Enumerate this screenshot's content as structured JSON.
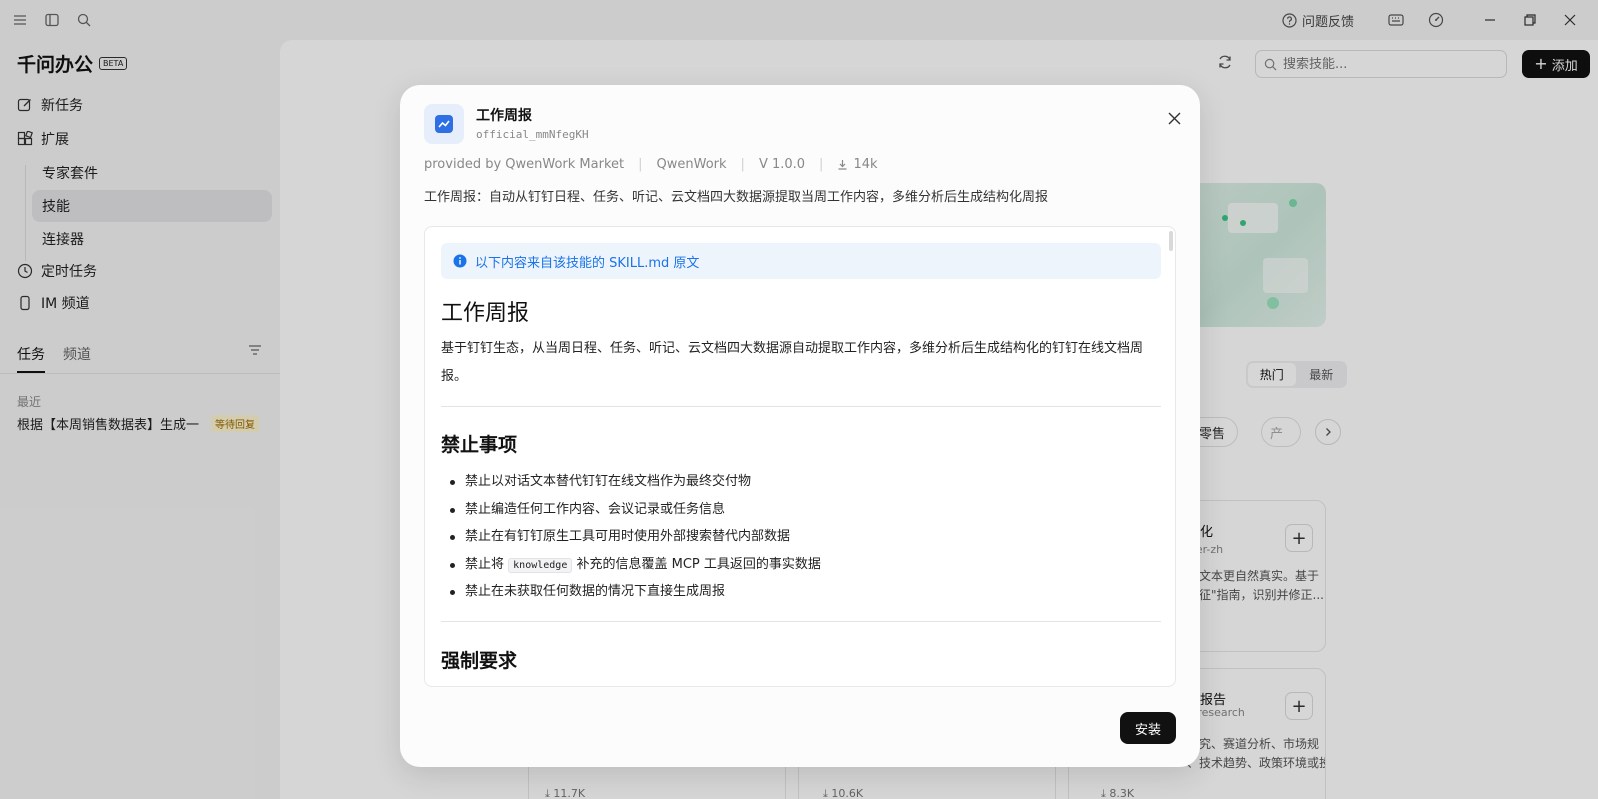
{
  "titlebar": {
    "feedback": "问题反馈"
  },
  "sidebar": {
    "brand": "千问办公",
    "beta": "BETA",
    "new_task": "新任务",
    "extensions": "扩展",
    "sub_items": [
      "专家套件",
      "技能",
      "连接器"
    ],
    "scheduled": "定时任务",
    "im_channel": "IM 频道",
    "tabs": [
      "任务",
      "频道"
    ],
    "recent_label": "最近",
    "task": {
      "text": "根据【本周销售数据表】生成一",
      "badge": "等待回复"
    }
  },
  "main": {
    "search_placeholder": "搜索技能...",
    "add_label": "添加",
    "segment": [
      "热门",
      "最新"
    ],
    "chips": [
      "电商零售",
      "产"
    ],
    "cards": [
      {
        "title": "优化",
        "sub": "izer-zh",
        "desc1": "使文本更自然真实。基于",
        "desc2": "特征\"指南，识别并修正..."
      },
      {
        "title": "究报告",
        "sub": "y-research",
        "desc1": "研究、赛道分析、市场规",
        "desc2": "、技术趋势、政策环境或投..."
      }
    ],
    "downloads": [
      "11.7K",
      "10.6K",
      "8.3K"
    ]
  },
  "modal": {
    "title": "工作周报",
    "id": "official_mmNfegKH",
    "provider": "provided by QwenWork Market",
    "author": "QwenWork",
    "version": "V 1.0.0",
    "downloads": "14k",
    "description": "工作周报：自动从钉钉日程、任务、听记、云文档四大数据源提取当周工作内容，多维分析后生成结构化周报",
    "info_bar": "以下内容来自该技能的 SKILL.md 原文",
    "doc": {
      "h1": "工作周报",
      "intro": "基于钉钉生态，从当周日程、任务、听记、云文档四大数据源自动提取工作内容，多维分析后生成结构化的钉钉在线文档周报。",
      "section1": "禁止事项",
      "rules": [
        "禁止以对话文本替代钉钉在线文档作为最终交付物",
        "禁止编造任何工作内容、会议记录或任务信息",
        "禁止在有钉钉原生工具可用时使用外部搜索替代内部数据",
        "禁止在未获取任何数据的情况下直接生成周报"
      ],
      "rule4_pre": "禁止将",
      "rule4_code": "knowledge",
      "rule4_post": "补充的信息覆盖 MCP 工具返回的事实数据",
      "section2": "强制要求"
    },
    "install": "安装"
  },
  "colors": {
    "accent_blue": "#1a73e8",
    "info_bg": "#eef4fc",
    "primary_dark": "#111111",
    "badge_bg": "#fdf3d0"
  }
}
